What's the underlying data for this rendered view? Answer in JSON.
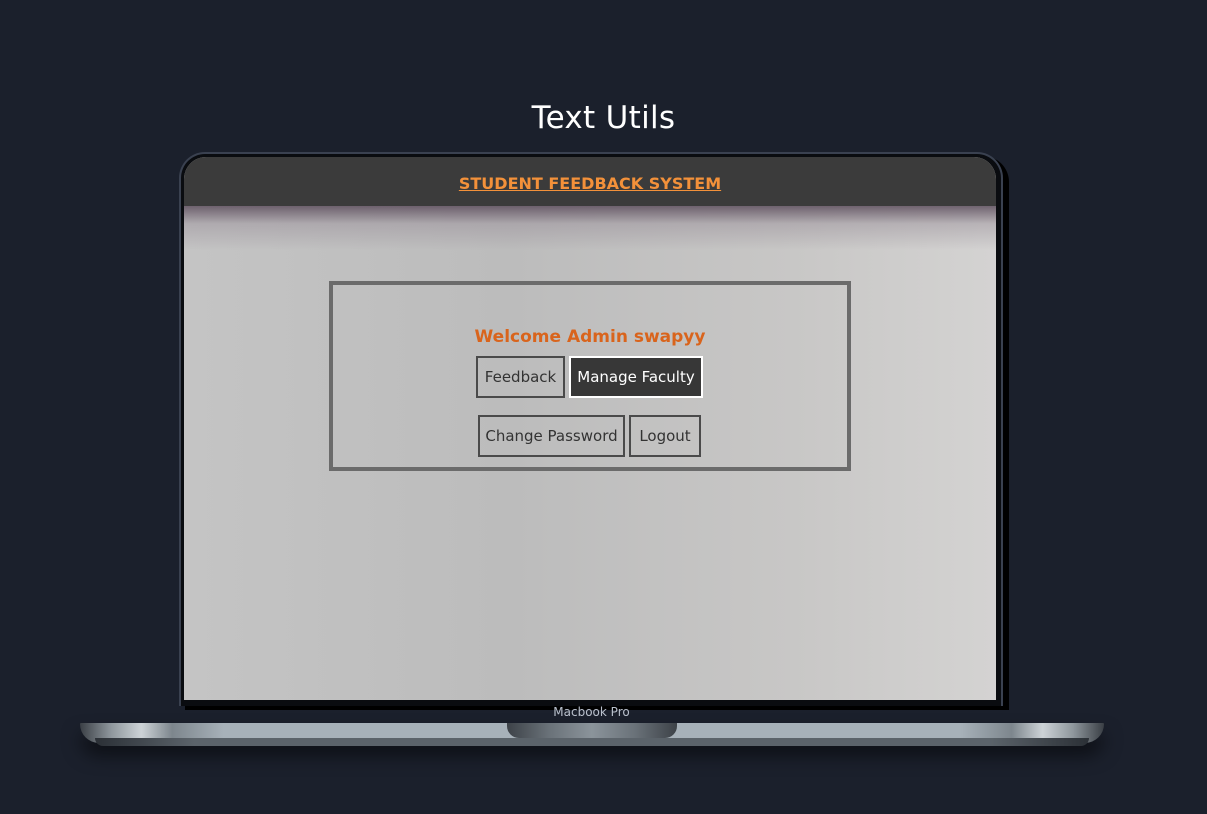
{
  "page": {
    "title": "Text Utils"
  },
  "app": {
    "nav_title": "STUDENT FEEDBACK SYSTEM",
    "welcome": "Welcome Admin swapyy",
    "buttons": {
      "feedback": "Feedback",
      "manage_faculty": "Manage Faculty",
      "change_password": "Change Password",
      "logout": "Logout"
    },
    "active_button": "manage_faculty"
  },
  "device": {
    "label": "Macbook Pro"
  },
  "colors": {
    "background": "#1b202c",
    "nav_bar": "#3b3b3b",
    "brand_orange": "#f3913a",
    "welcome_orange": "#d9641c",
    "active_button_bg": "#373737"
  }
}
